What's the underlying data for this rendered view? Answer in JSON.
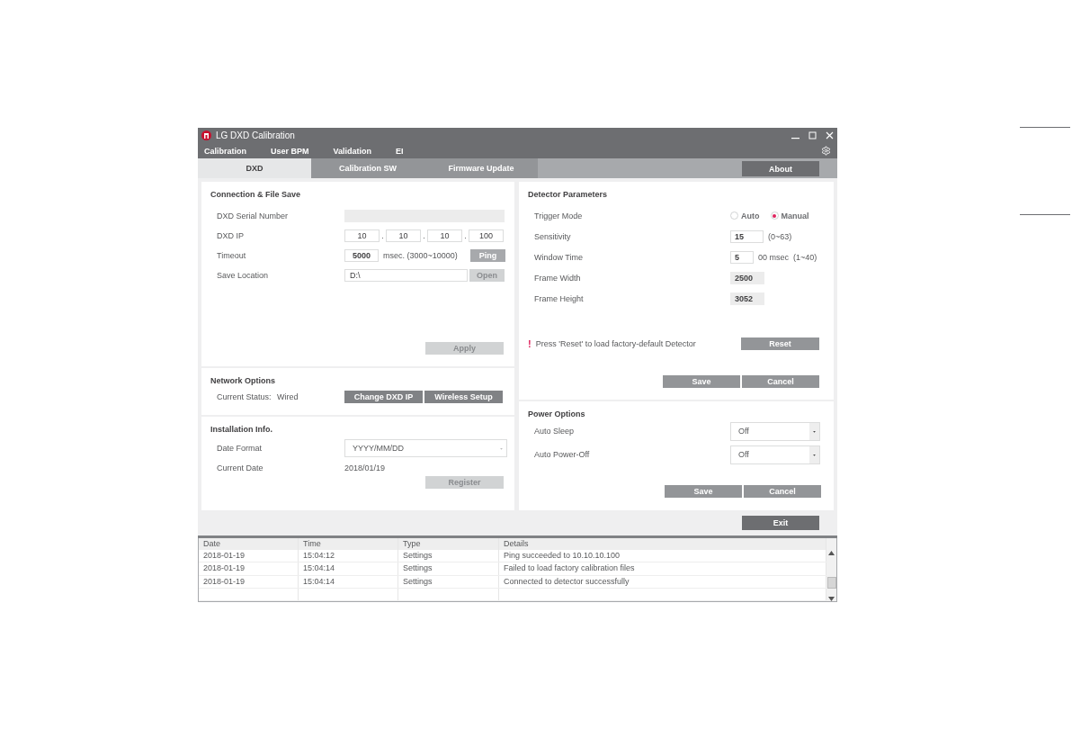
{
  "window": {
    "title": "LG DXD Calibration"
  },
  "menu": [
    "Calibration",
    "User BPM",
    "Validation",
    "EI"
  ],
  "tabs": [
    {
      "label": "DXD",
      "selected": true
    },
    {
      "label": "Calibration SW",
      "selected": false
    },
    {
      "label": "Firmware Update",
      "selected": false
    }
  ],
  "about_button": "About",
  "connection": {
    "title": "Connection & File Save",
    "fields": [
      {
        "kind": "readonly",
        "label": "DXD Serial Number"
      },
      {
        "kind": "ip",
        "label": "DXD IP",
        "octets": [
          "10",
          "10",
          "10",
          "100"
        ],
        "separator": "."
      },
      {
        "kind": "number",
        "label": "Timeout",
        "value": "5000",
        "hint": "msec. (3000~10000)",
        "button": {
          "label": "Ping",
          "disabled": false
        }
      },
      {
        "kind": "path",
        "label": "Save Location",
        "value": "D:\\",
        "button": {
          "label": "Open",
          "disabled": true
        }
      }
    ],
    "apply": {
      "label": "Apply",
      "disabled": true
    }
  },
  "network": {
    "title": "Network Options",
    "status_label": "Current Status:",
    "status_value": "Wired",
    "buttons": [
      "Change DXD IP",
      "Wireless Setup"
    ]
  },
  "installation": {
    "title": "Installation Info.",
    "date_format": {
      "label": "Date Format",
      "value": "YYYY/MM/DD"
    },
    "current_date": {
      "label": "Current Date",
      "value": "2018/01/19"
    },
    "register": {
      "label": "Register",
      "disabled": true
    }
  },
  "detector": {
    "title": "Detector Parameters",
    "trigger_mode": {
      "label": "Trigger Mode",
      "options": [
        {
          "label": "Auto",
          "selected": false
        },
        {
          "label": "Manual",
          "selected": true
        }
      ]
    },
    "params": [
      {
        "kind": "input",
        "label": "Sensitivity",
        "value": "15",
        "hint": "(0~63)"
      },
      {
        "kind": "input",
        "label": "Window Time",
        "value": "5",
        "unit": "00 msec",
        "hint": "(1~40)"
      },
      {
        "kind": "readonly",
        "label": "Frame Width",
        "value": "2500"
      },
      {
        "kind": "readonly",
        "label": "Frame Height",
        "value": "3052"
      }
    ],
    "notice_mark": "!",
    "notice": "Press 'Reset' to load factory-default Detector",
    "reset": "Reset",
    "buttons": [
      "Save",
      "Cancel"
    ]
  },
  "power": {
    "title": "Power Options",
    "settings": [
      {
        "label": "Auto Sleep",
        "value": "Off"
      },
      {
        "label": "Auto Power-Off",
        "value": "Off"
      }
    ],
    "buttons": [
      "Save",
      "Cancel"
    ]
  },
  "exit_button": "Exit",
  "log": {
    "columns": [
      "Date",
      "Time",
      "Type",
      "Details"
    ],
    "rows": [
      [
        "2018-01-19",
        "15:04:12",
        "Settings",
        "Ping succeeded to  10.10.10.100"
      ],
      [
        "2018-01-19",
        "15:04:14",
        "Settings",
        "Failed to load factory calibration files"
      ],
      [
        "2018-01-19",
        "15:04:14",
        "Settings",
        "Connected to detector successfully"
      ]
    ]
  }
}
